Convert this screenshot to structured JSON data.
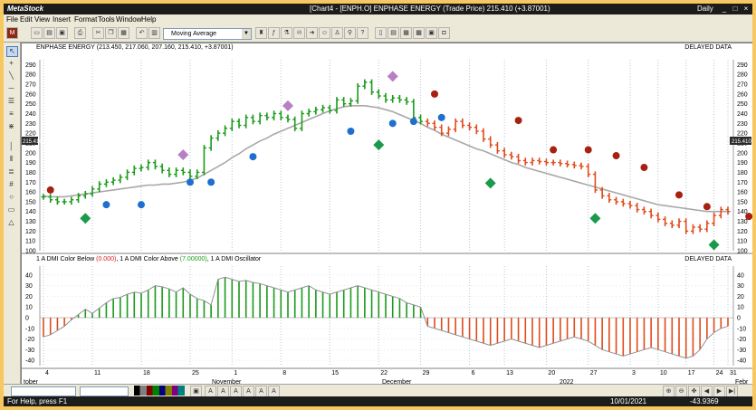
{
  "titlebar": {
    "app": "MetaStock",
    "document": "[Chart4 - [ENPH.O] ENPHASE ENERGY (Trade Price)  215.410 (+3.87001)",
    "mode": "Daily"
  },
  "menu": [
    "File",
    "Edit",
    "View",
    "Insert",
    "Format",
    "Tools",
    "Window",
    "Help"
  ],
  "toolbar": {
    "indicator_select": "Moving Average"
  },
  "price_panel": {
    "title": "ENPHASE ENERGY (213.450, 217.060, 207.160, 215.410, +3.87001)",
    "delayed": "DELAYED DATA",
    "last_price_tag": "215.410",
    "y_ticks": [
      "290",
      "280",
      "270",
      "260",
      "250",
      "240",
      "230",
      "220",
      "210",
      "200",
      "190",
      "180",
      "170",
      "160",
      "150",
      "140",
      "130",
      "120",
      "110",
      "100"
    ]
  },
  "dmi_panel": {
    "title_a": "1 A DMI Color Below ",
    "title_a_val": "(0.000)",
    "title_b": ", 1 A DMI Color Above ",
    "title_b_val": "(7.00000)",
    "title_c": ", 1 A DMI Oscillator",
    "delayed": "DELAYED DATA",
    "y_ticks": [
      "40",
      "30",
      "20",
      "10",
      "0",
      "-10",
      "-20",
      "-30",
      "-40"
    ]
  },
  "x_axis": {
    "days": [
      "4",
      "11",
      "18",
      "25",
      "1",
      "8",
      "15",
      "22",
      "29",
      "6",
      "13",
      "20",
      "27",
      "3",
      "10",
      "17",
      "24",
      "31"
    ],
    "months": [
      "tober",
      "November",
      "December",
      "2022",
      "Febr"
    ]
  },
  "chart_data": {
    "type": "bar",
    "price_range": [
      100,
      295
    ],
    "ohlc_closes": [
      155,
      152,
      150,
      150,
      152,
      156,
      158,
      163,
      168,
      170,
      172,
      175,
      180,
      184,
      185,
      190,
      186,
      182,
      178,
      182,
      180,
      176,
      180,
      205,
      215,
      220,
      225,
      232,
      228,
      236,
      232,
      238,
      236,
      240,
      236,
      234,
      225,
      240,
      242,
      244,
      246,
      243,
      254,
      250,
      253,
      268,
      272,
      262,
      258,
      254,
      256,
      254,
      252,
      236,
      232,
      230,
      226,
      220,
      224,
      232,
      228,
      226,
      222,
      214,
      208,
      202,
      198,
      196,
      192,
      190,
      192,
      191,
      190,
      190,
      189,
      188,
      187,
      186,
      178,
      162,
      156,
      152,
      150,
      148,
      146,
      142,
      140,
      136,
      132,
      128,
      126,
      130,
      120,
      124,
      122,
      128,
      136,
      142,
      140
    ],
    "moving_average": [
      156,
      155,
      155,
      155,
      156,
      157,
      158,
      159,
      160,
      161,
      162,
      163,
      164,
      165,
      166,
      167,
      167,
      168,
      168,
      169,
      170,
      172,
      174,
      178,
      182,
      186,
      190,
      195,
      199,
      204,
      208,
      212,
      215,
      219,
      222,
      225,
      228,
      231,
      234,
      237,
      240,
      243,
      245,
      247,
      248,
      248,
      248,
      247,
      246,
      244,
      242,
      239,
      236,
      233,
      230,
      226,
      223,
      219,
      216,
      213,
      210,
      207,
      204,
      202,
      199,
      196,
      193,
      190,
      188,
      185,
      183,
      181,
      179,
      177,
      175,
      173,
      171,
      169,
      167,
      165,
      163,
      161,
      159,
      157,
      155,
      153,
      151,
      149,
      147,
      146,
      145,
      144,
      143,
      142,
      141,
      140,
      140,
      140,
      140
    ],
    "dmi_oscillator": [
      -18,
      -16,
      -12,
      -8,
      -2,
      3,
      8,
      4,
      9,
      14,
      18,
      19,
      22,
      24,
      23,
      26,
      30,
      29,
      27,
      24,
      28,
      22,
      18,
      16,
      12,
      36,
      38,
      36,
      34,
      35,
      33,
      32,
      30,
      28,
      26,
      24,
      26,
      28,
      30,
      26,
      24,
      22,
      24,
      26,
      28,
      30,
      28,
      26,
      24,
      22,
      20,
      18,
      14,
      12,
      10,
      -8,
      -10,
      -12,
      -14,
      -16,
      -18,
      -20,
      -22,
      -24,
      -26,
      -24,
      -22,
      -20,
      -22,
      -24,
      -26,
      -28,
      -26,
      -24,
      -22,
      -20,
      -18,
      -20,
      -22,
      -26,
      -30,
      -32,
      -34,
      -36,
      -34,
      -32,
      -30,
      -28,
      -30,
      -32,
      -34,
      -36,
      -38,
      -36,
      -30,
      -20,
      -14,
      -10,
      -8
    ],
    "buy_diamonds": [
      {
        "x": 6,
        "y": 133
      },
      {
        "x": 48,
        "y": 208
      },
      {
        "x": 64,
        "y": 169
      },
      {
        "x": 79,
        "y": 133
      },
      {
        "x": 96,
        "y": 106
      }
    ],
    "sell_diamonds": [
      {
        "x": 20,
        "y": 198
      },
      {
        "x": 35,
        "y": 248
      },
      {
        "x": 50,
        "y": 278
      }
    ],
    "blue_dots": [
      {
        "x": 9,
        "y": 147
      },
      {
        "x": 14,
        "y": 147
      },
      {
        "x": 21,
        "y": 170
      },
      {
        "x": 24,
        "y": 170
      },
      {
        "x": 30,
        "y": 196
      },
      {
        "x": 44,
        "y": 222
      },
      {
        "x": 50,
        "y": 230
      },
      {
        "x": 53,
        "y": 232
      },
      {
        "x": 57,
        "y": 236
      }
    ],
    "red_dots": [
      {
        "x": 1,
        "y": 162
      },
      {
        "x": 56,
        "y": 260
      },
      {
        "x": 68,
        "y": 233
      },
      {
        "x": 73,
        "y": 203
      },
      {
        "x": 78,
        "y": 203
      },
      {
        "x": 82,
        "y": 197
      },
      {
        "x": 86,
        "y": 185
      },
      {
        "x": 91,
        "y": 157
      },
      {
        "x": 95,
        "y": 145
      },
      {
        "x": 101,
        "y": 135
      }
    ]
  },
  "colors": {
    "up": "#1a9a1a",
    "down": "#e04a1a",
    "ma": "#a8a8a8",
    "buy": "#1a9a4a",
    "sell": "#b77fc4",
    "blue": "#1f6fcc",
    "red": "#a82010"
  },
  "status": {
    "help": "For Help, press F1",
    "date": "10/01/2021",
    "value": "-43.9369"
  }
}
